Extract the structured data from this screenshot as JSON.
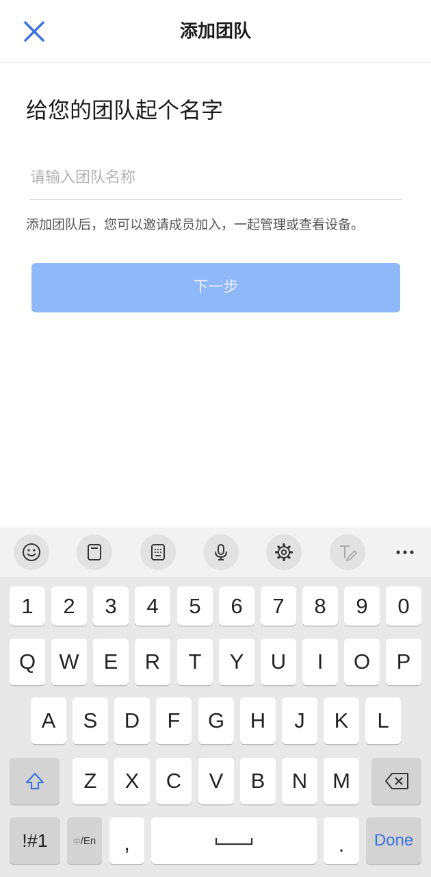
{
  "header": {
    "title": "添加团队"
  },
  "page": {
    "heading": "给您的团队起个名字",
    "input_placeholder": "请输入团队名称",
    "input_value": "",
    "hint": "添加团队后，您可以邀请成员加入，一起管理或查看设备。",
    "next_label": "下一步"
  },
  "keyboard": {
    "toolbar": [
      "emoji-icon",
      "clipboard-icon",
      "keypad-icon",
      "microphone-icon",
      "gear-icon",
      "handwriting-icon",
      "more-icon"
    ],
    "row_numbers": [
      "1",
      "2",
      "3",
      "4",
      "5",
      "6",
      "7",
      "8",
      "9",
      "0"
    ],
    "row_top": [
      "Q",
      "W",
      "E",
      "R",
      "T",
      "Y",
      "U",
      "I",
      "O",
      "P"
    ],
    "row_home": [
      "A",
      "S",
      "D",
      "F",
      "G",
      "H",
      "J",
      "K",
      "L"
    ],
    "row_bottom": [
      "Z",
      "X",
      "C",
      "V",
      "B",
      "N",
      "M"
    ],
    "symbols_label": "!#1",
    "lang_zh": "中",
    "lang_rest": "/En",
    "comma": ",",
    "period": ".",
    "done_label": "Done"
  },
  "colors": {
    "accent": "#3a73e0",
    "button_disabled": "#8fb8f9",
    "keyboard_bg": "#e8e8e8"
  }
}
